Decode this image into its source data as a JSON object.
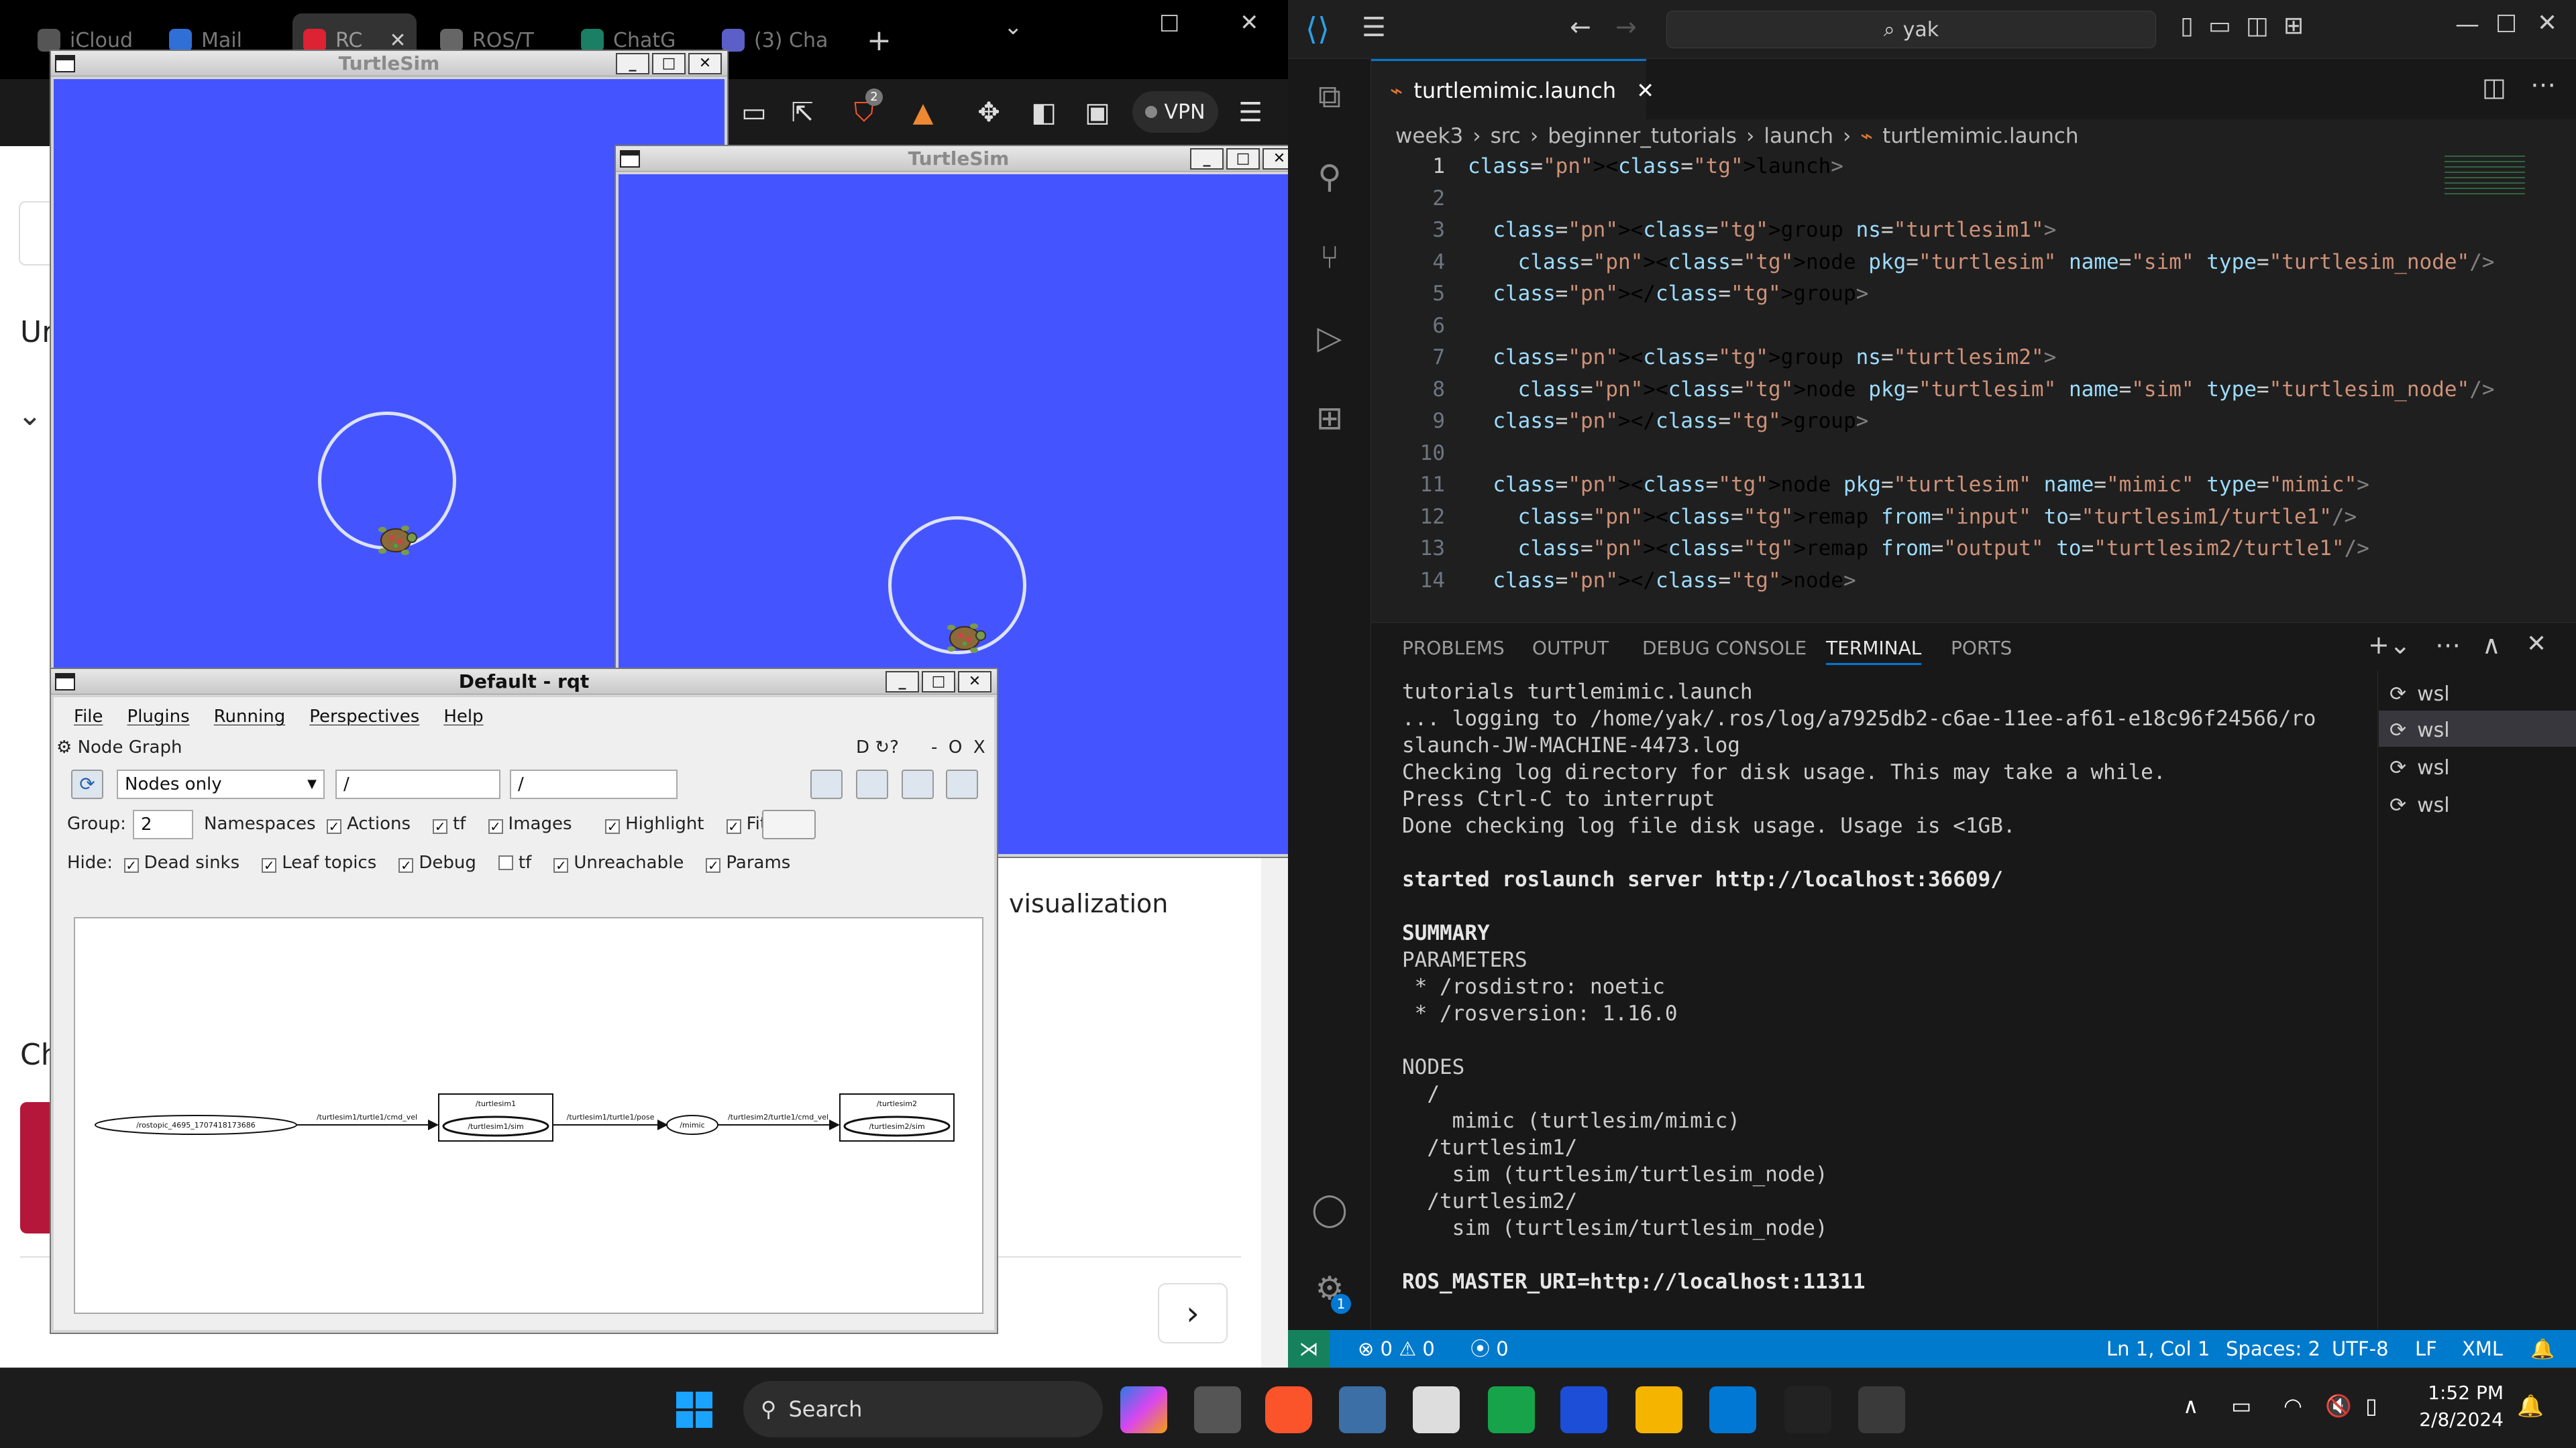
{
  "browser": {
    "tabs": [
      "iCloud",
      "Mail",
      "RC",
      "ROS/T",
      "ChatG",
      "(3) Cha"
    ],
    "new_tab": "+",
    "vpn_label": "VPN",
    "brave_badge": "2",
    "page_fragments": {
      "u": "Ur",
      "c": "Ch",
      "visualization": "visualization"
    }
  },
  "turtlesim1": {
    "title": "TurtleSim",
    "bg_color": "#4455ff"
  },
  "turtlesim2": {
    "title": "TurtleSim",
    "bg_color": "#4455ff"
  },
  "rqt": {
    "title": "Default - rqt",
    "menus": [
      "File",
      "Plugins",
      "Running",
      "Perspectives",
      "Help"
    ],
    "plugin_title": "Node Graph",
    "plugin_buttons": "D",
    "plugin_controls": [
      "-",
      "O",
      "X"
    ],
    "mode": "Nodes only",
    "filter1": "/",
    "filter2": "/",
    "group_label": "Group:",
    "group_value": "2",
    "options": [
      "Namespaces",
      "Actions",
      "tf",
      "Images",
      "Highlight",
      "Fit"
    ],
    "hide_label": "Hide:",
    "hide_options": [
      "Dead sinks",
      "Leaf topics",
      "Debug",
      "tf",
      "Unreachable",
      "Params"
    ],
    "graph": {
      "nodes": [
        "/rostopic_4695_1707418173686",
        "/turtlesim1/sim",
        "/mimic",
        "/turtlesim2/sim"
      ],
      "clusters": [
        "/turtlesim1",
        "/turtlesim2"
      ],
      "edges": [
        "/turtlesim1/turtle1/cmd_vel",
        "/turtlesim1/turtle1/pose",
        "/turtlesim2/turtle1/cmd_vel"
      ]
    }
  },
  "vscode": {
    "search": "yak",
    "file_tab": "turtlemimic.launch",
    "breadcrumb": [
      "week3",
      "src",
      "beginner_tutorials",
      "launch",
      "turtlemimic.launch"
    ],
    "code_lines": [
      {
        "n": "1",
        "t": "<launch>"
      },
      {
        "n": "2",
        "t": ""
      },
      {
        "n": "3",
        "t": "  <group ns=\"turtlesim1\">"
      },
      {
        "n": "4",
        "t": "    <node pkg=\"turtlesim\" name=\"sim\" type=\"turtlesim_node\"/>"
      },
      {
        "n": "5",
        "t": "  </group>"
      },
      {
        "n": "6",
        "t": ""
      },
      {
        "n": "7",
        "t": "  <group ns=\"turtlesim2\">"
      },
      {
        "n": "8",
        "t": "    <node pkg=\"turtlesim\" name=\"sim\" type=\"turtlesim_node\"/>"
      },
      {
        "n": "9",
        "t": "  </group>"
      },
      {
        "n": "10",
        "t": ""
      },
      {
        "n": "11",
        "t": "  <node pkg=\"turtlesim\" name=\"mimic\" type=\"mimic\">"
      },
      {
        "n": "12",
        "t": "    <remap from=\"input\" to=\"turtlesim1/turtle1\"/>"
      },
      {
        "n": "13",
        "t": "    <remap from=\"output\" to=\"turtlesim2/turtle1\"/>"
      },
      {
        "n": "14",
        "t": "  </node>"
      }
    ],
    "panel_tabs": [
      "PROBLEMS",
      "OUTPUT",
      "DEBUG CONSOLE",
      "TERMINAL",
      "PORTS"
    ],
    "terminal_lines": [
      "tutorials turtlemimic.launch",
      "... logging to /home/yak/.ros/log/a7925db2-c6ae-11ee-af61-e18c96f24566/ro",
      "slaunch-JW-MACHINE-4473.log",
      "Checking log directory for disk usage. This may take a while.",
      "Press Ctrl-C to interrupt",
      "Done checking log file disk usage. Usage is <1GB.",
      "",
      "started roslaunch server http://localhost:36609/",
      "",
      "SUMMARY",
      "PARAMETERS",
      " * /rosdistro: noetic",
      " * /rosversion: 1.16.0",
      "",
      "NODES",
      "  /",
      "    mimic (turtlesim/mimic)",
      "  /turtlesim1/",
      "    sim (turtlesim/turtlesim_node)",
      "  /turtlesim2/",
      "    sim (turtlesim/turtlesim_node)",
      "",
      "ROS_MASTER_URI=http://localhost:11311"
    ],
    "terminals": [
      "wsl",
      "wsl",
      "wsl",
      "wsl"
    ],
    "status": {
      "errors": "0",
      "warnings": "0",
      "ports": "0",
      "position": "Ln 1, Col 1",
      "spaces": "Spaces: 2",
      "encoding": "UTF-8",
      "eol": "LF",
      "language": "XML"
    },
    "settings_badge": "1"
  },
  "taskbar": {
    "search": "Search",
    "time": "1:52 PM",
    "date": "2/8/2024"
  }
}
